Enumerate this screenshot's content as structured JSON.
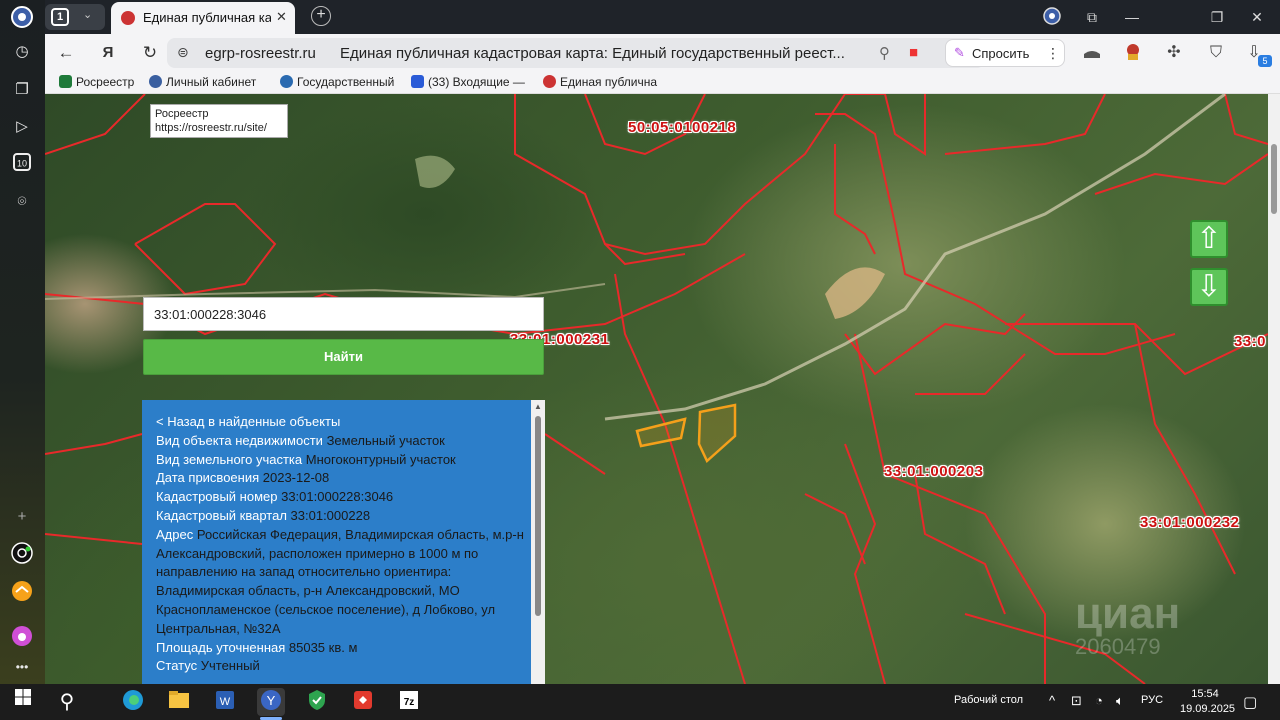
{
  "browser": {
    "tab_count": "1",
    "active_tab_title": "Единая публичная када",
    "url_domain": "egrp-rosreestr.ru",
    "url_page_title": "Единая публичная кадастровая карта: Единый государственный реест...",
    "ask_button_label": "Спросить",
    "extension_badge": "5"
  },
  "bookmarks": [
    {
      "label": "Росреестр",
      "color": "#1f7a3a"
    },
    {
      "label": "Личный кабинет",
      "color": "#3a5fa0"
    },
    {
      "label": "Государственный",
      "color": "#2a6ab0"
    },
    {
      "label": "(33) Входящие —",
      "color": "#2a5bd7"
    },
    {
      "label": "Единая публична",
      "color": "#c33"
    }
  ],
  "tooltip": {
    "title": "Росреестр",
    "url": "https://rosreestr.ru/site/"
  },
  "search": {
    "value": "33:01:000228:3046",
    "button_label": "Найти"
  },
  "info": {
    "back_link": "< Назад в найденные объекты",
    "rows": [
      {
        "key": "Вид объекта недвижимости",
        "value": "Земельный участок"
      },
      {
        "key": "Вид земельного участка",
        "value": "Многоконтурный участок"
      },
      {
        "key": "Дата присвоения",
        "value": "2023-12-08"
      },
      {
        "key": "Кадастровый номер",
        "value": "33:01:000228:3046"
      },
      {
        "key": "Кадастровый квартал",
        "value": "33:01:000228"
      },
      {
        "key": "Адрес",
        "value": "Российская Федерация, Владимирская область, м.р-н Александровский, расположен примерно в 1000 м по направлению на запад относительно ориентира: Владимирская область, р-н Александровский, МО Краснопламенское (сельское поселение), д Лобково, ул Центральная, №32А"
      },
      {
        "key": "Площадь уточненная",
        "value": "85035 кв. м"
      },
      {
        "key": "Статус",
        "value": "Учтенный"
      }
    ]
  },
  "map_labels": {
    "q1": "50:05:0100218",
    "q2": "33:01:000231",
    "q3": "33:01:000203",
    "q4": "33:01:000232",
    "q5": "33:0"
  },
  "watermark": {
    "brand": "циан",
    "phone": "2060479"
  },
  "taskbar": {
    "desktop_label": "Рабочий стол",
    "language": "РУС",
    "time": "15:54",
    "date": "19.09.2025"
  },
  "colors": {
    "boundary": "#e8292a",
    "parcel": "#f5a01a",
    "find_button": "#58b947",
    "info_panel": "#2c7ec9"
  }
}
